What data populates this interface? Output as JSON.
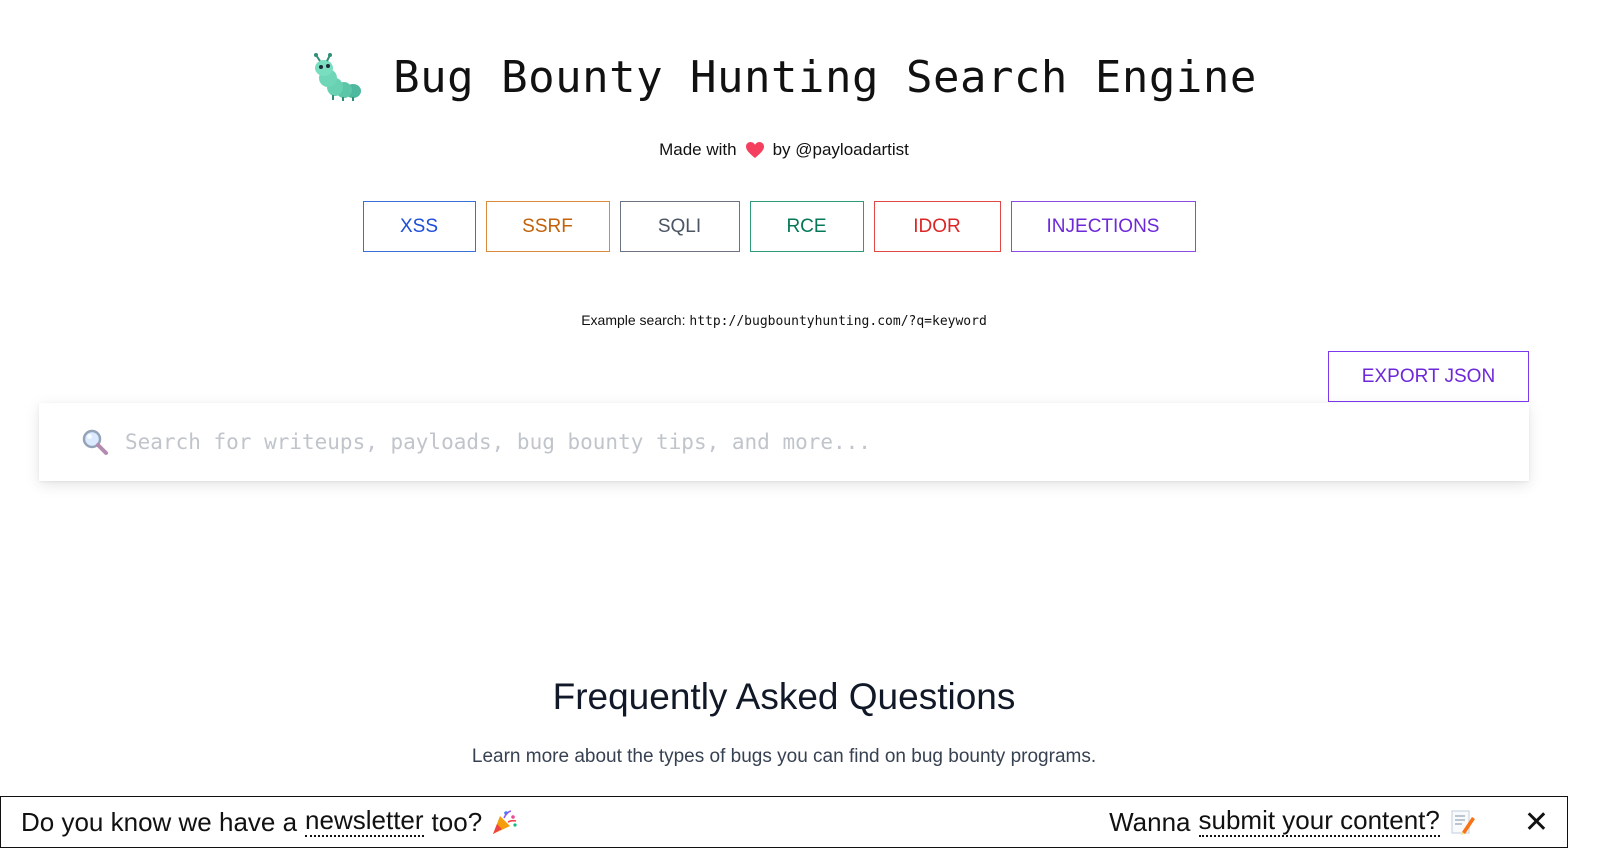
{
  "header": {
    "title": "Bug Bounty Hunting Search Engine",
    "made_with_prefix": "Made with",
    "made_with_suffix": "by @payloadartist"
  },
  "categories": [
    {
      "label": "XSS",
      "color": "#1d4ed8"
    },
    {
      "label": "SSRF",
      "color": "#c2620a"
    },
    {
      "label": "SQLI",
      "color": "#4b5563"
    },
    {
      "label": "RCE",
      "color": "#047857"
    },
    {
      "label": "IDOR",
      "color": "#dc2626"
    },
    {
      "label": "INJECTIONS",
      "color": "#6d28d9"
    }
  ],
  "example": {
    "label": "Example search:",
    "url": "http://bugbountyhunting.com/?q=keyword"
  },
  "export_button": "EXPORT JSON",
  "search": {
    "placeholder": "Search for writeups, payloads, bug bounty tips, and more...",
    "value": ""
  },
  "faq": {
    "title": "Frequently Asked Questions",
    "subtitle": "Learn more about the types of bugs you can find on bug bounty programs."
  },
  "banner": {
    "left_text": "Do you know we have a",
    "left_link": "newsletter",
    "left_suffix": "too?",
    "right_text": "Wanna",
    "right_link": "submit your content?",
    "close_symbol": "✕"
  }
}
